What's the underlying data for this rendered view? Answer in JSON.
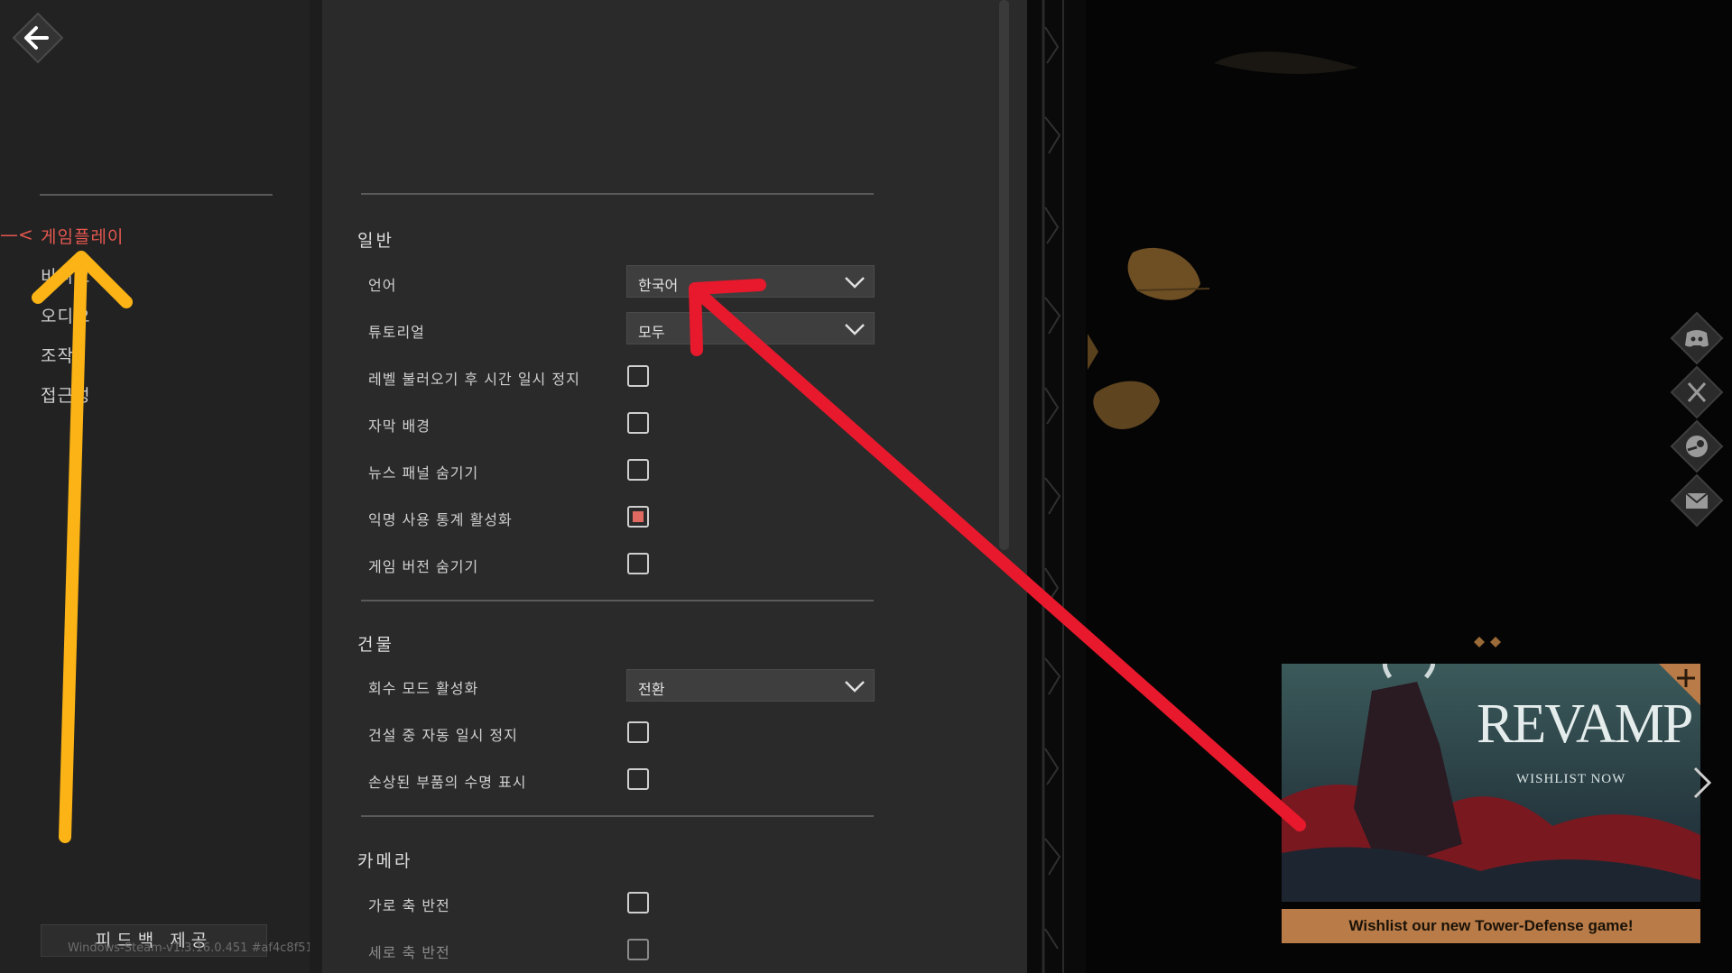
{
  "nav": {
    "marker": "—<",
    "items": [
      {
        "label": "게임플레이",
        "active": true
      },
      {
        "label": "비디오",
        "active": false
      },
      {
        "label": "오디오",
        "active": false
      },
      {
        "label": "조작",
        "active": false
      },
      {
        "label": "접근성",
        "active": false
      }
    ],
    "feedback_label": "피드백 제공",
    "version": "Windows-Steam-v1.3.16.0.451 #af4c8f51"
  },
  "sections": {
    "general": {
      "title": "일반",
      "language_label": "언어",
      "language_value": "한국어",
      "tutorial_label": "튜토리얼",
      "tutorial_value": "모두",
      "pause_after_load_label": "레벨 불러오기 후 시간 일시 정지",
      "subtitle_bg_label": "자막 배경",
      "hide_news_label": "뉴스 패널 숨기기",
      "anon_stats_label": "익명 사용 통계 활성화",
      "hide_version_label": "게임 버전 숨기기"
    },
    "buildings": {
      "title": "건물",
      "recycle_mode_label": "회수 모드 활성화",
      "recycle_mode_value": "전환",
      "auto_pause_label": "건설 중 자동 일시 정지",
      "show_durability_label": "손상된 부품의 수명 표시"
    },
    "camera": {
      "title": "카메라",
      "invert_x_label": "가로 축 반전",
      "invert_y_label": "세로 축 반전"
    }
  },
  "checkbox_states": {
    "pause_after_load": false,
    "subtitle_bg": false,
    "hide_news": false,
    "anon_stats": true,
    "hide_version": false,
    "auto_pause": false,
    "show_durability": false,
    "invert_x": false,
    "invert_y": false
  },
  "social_icons": [
    "discord-icon",
    "x-icon",
    "steam-icon",
    "mail-icon"
  ],
  "promo": {
    "title": "REVAMP",
    "subtitle": "WISHLIST NOW",
    "banner": "Wishlist our new Tower-Defense game!"
  },
  "colors": {
    "accent": "#e4574f",
    "promo_banner": "#b97c48",
    "annotation_red": "#e8192c",
    "annotation_yellow": "#fbb315"
  }
}
